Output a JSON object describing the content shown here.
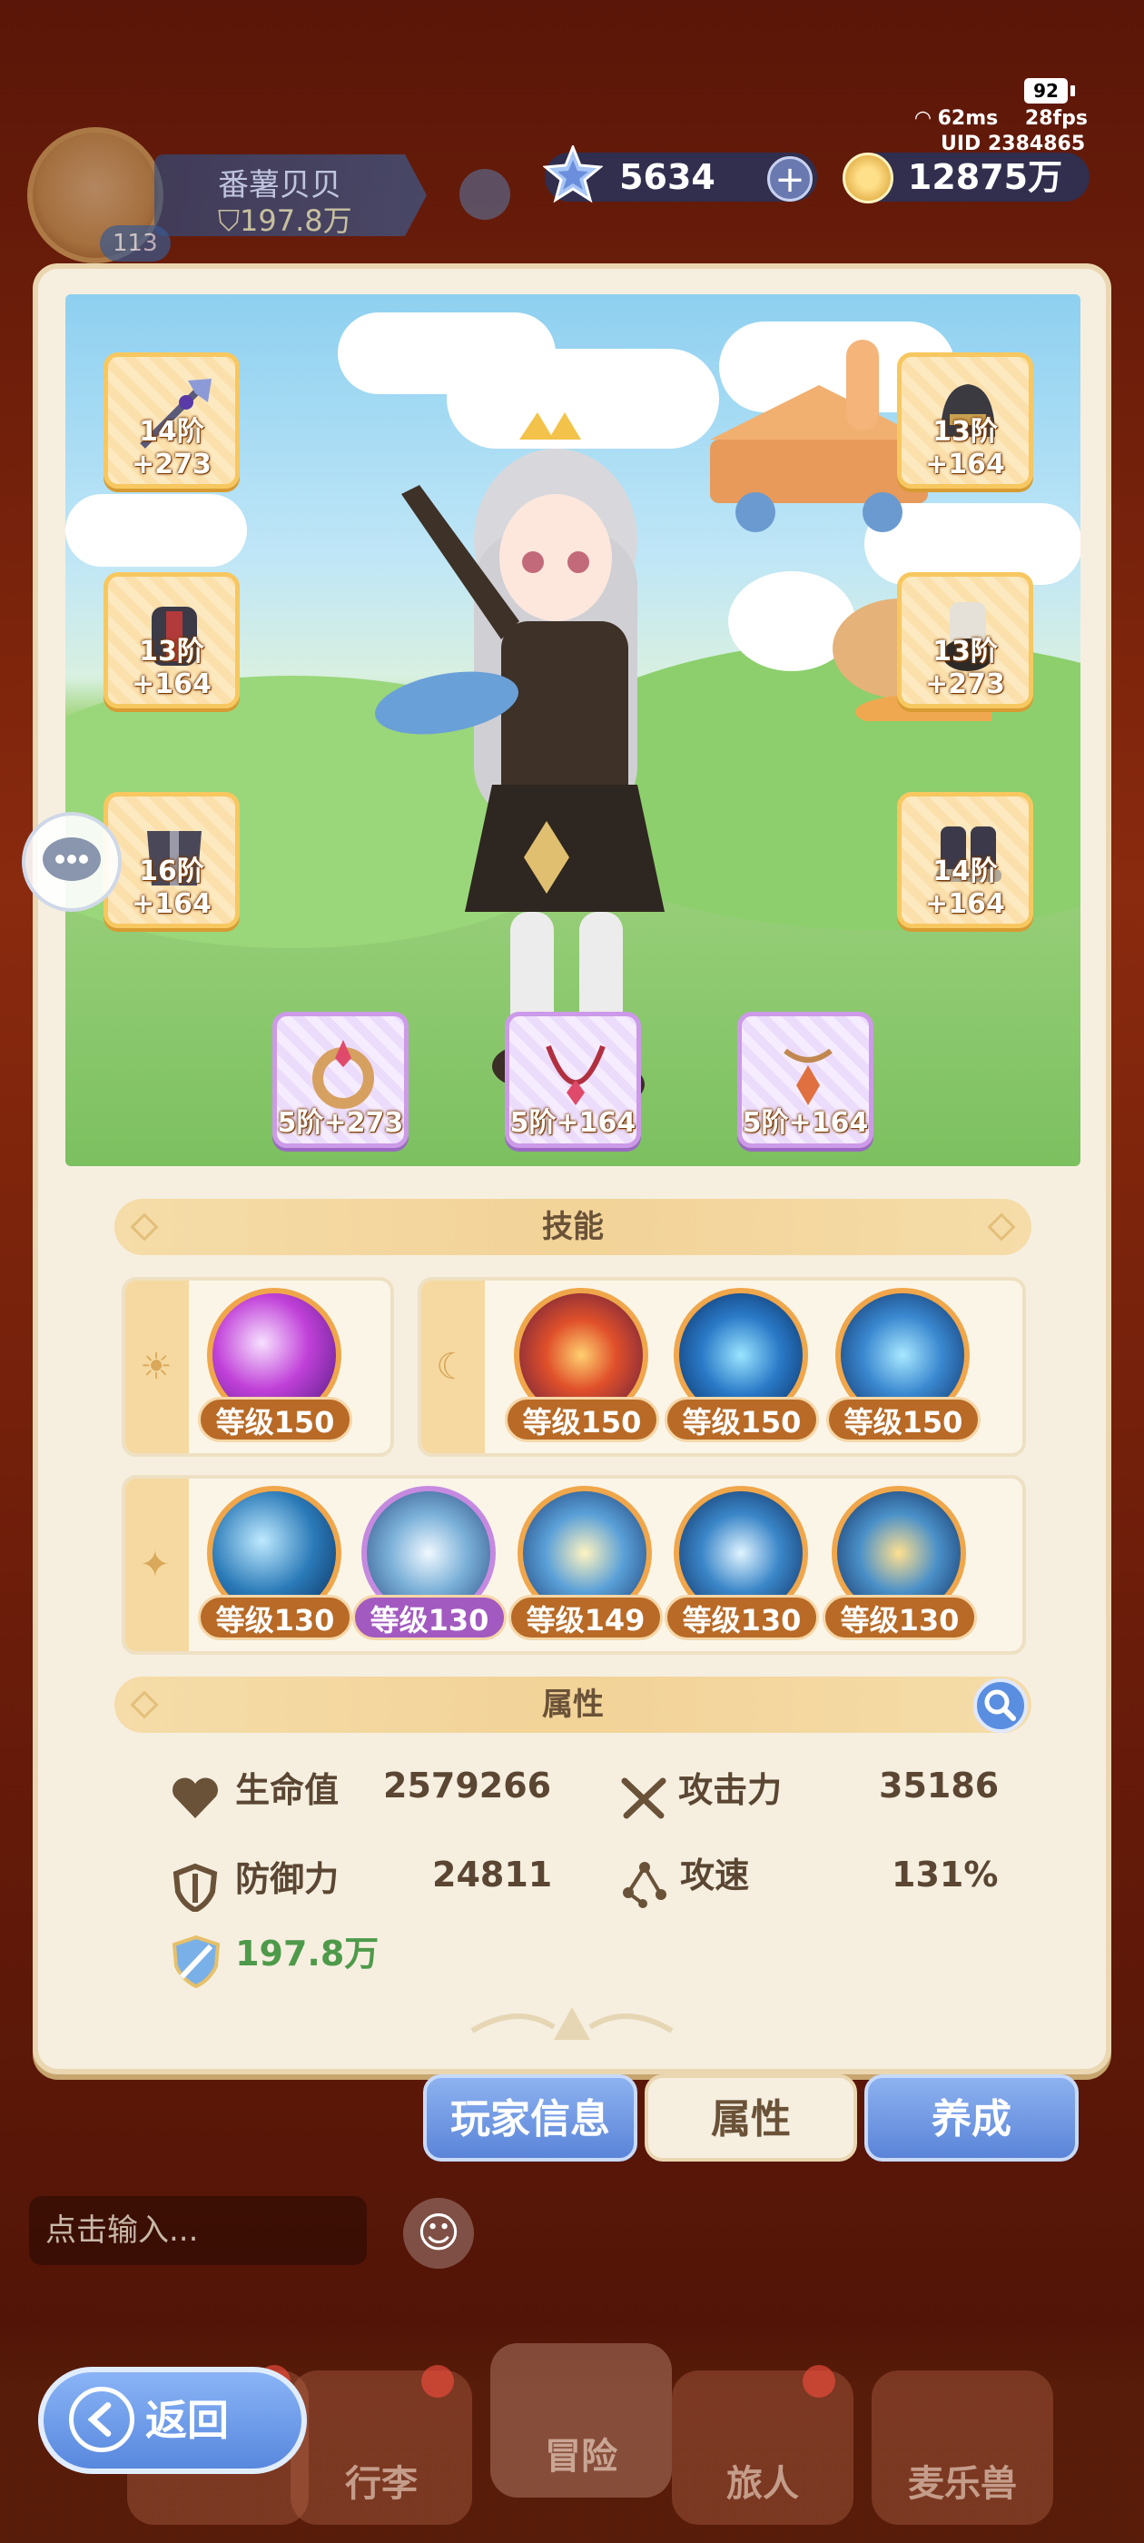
{
  "status": {
    "battery": "92",
    "ping": "62ms",
    "fps": "28fps",
    "uid": "UID 2384865"
  },
  "player": {
    "name": "番薯贝贝",
    "power": "197.8万",
    "level": "113"
  },
  "currency": {
    "gems": "5634",
    "gold": "12875万",
    "plus": "+"
  },
  "equipment": [
    {
      "label": "14阶+273"
    },
    {
      "label": "13阶+164"
    },
    {
      "label": "13阶+164"
    },
    {
      "label": "13阶+273"
    },
    {
      "label": "16阶+164"
    },
    {
      "label": "14阶+164"
    },
    {
      "label": "5阶+273"
    },
    {
      "label": "5阶+164"
    },
    {
      "label": "5阶+164"
    }
  ],
  "skills": {
    "title": "技能",
    "sun_icon": "☀",
    "moon_icon": "☾",
    "star_icon": "✦",
    "row1_left": [
      {
        "level": "等级150"
      }
    ],
    "row1_right": [
      {
        "level": "等级150"
      },
      {
        "level": "等级150"
      },
      {
        "level": "等级150"
      }
    ],
    "row2": [
      {
        "level": "等级130"
      },
      {
        "level": "等级130"
      },
      {
        "level": "等级149"
      },
      {
        "level": "等级130"
      },
      {
        "level": "等级130"
      }
    ]
  },
  "attributes": {
    "title": "属性",
    "hp_label": "生命值",
    "hp_value": "2579266",
    "atk_label": "攻击力",
    "atk_value": "35186",
    "def_label": "防御力",
    "def_value": "24811",
    "spd_label": "攻速",
    "spd_value": "131%",
    "power_value": "197.8万"
  },
  "tabs": {
    "player_info": "玩家信息",
    "attributes": "属性",
    "develop": "养成"
  },
  "chat": {
    "placeholder": "点击输入..."
  },
  "nav": {
    "back": "返回",
    "luggage": "行李",
    "adventure": "冒险",
    "travelers": "旅人",
    "pets": "麦乐兽"
  },
  "colors": {
    "accent_blue": "#5a84d8",
    "panel": "#f6efe0",
    "gold_border": "#f7c760"
  }
}
